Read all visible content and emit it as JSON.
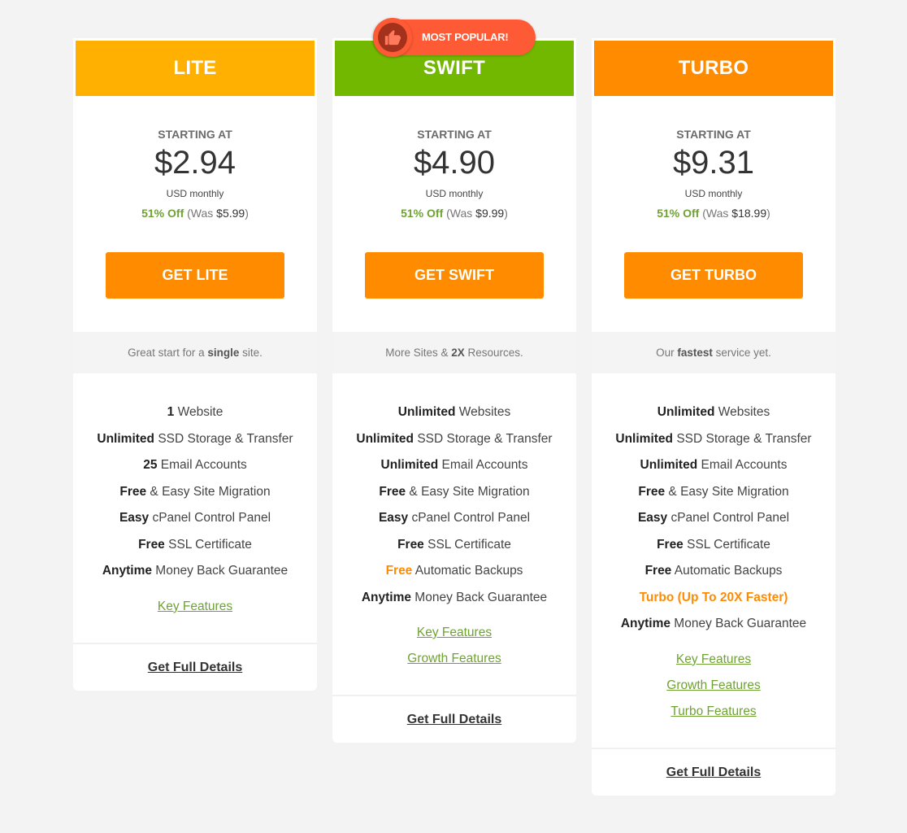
{
  "badge": {
    "label": "MOST POPULAR!",
    "icon": "thumbs-up-icon",
    "color": "#ff5a36"
  },
  "plans": [
    {
      "name": "LITE",
      "header_color": "#ffb000",
      "starting_label": "STARTING AT",
      "price": "$2.94",
      "period": "USD monthly",
      "discount": "51% Off",
      "was_prefix": "(Was ",
      "was_price": "$5.99",
      "was_suffix": ")",
      "button_label": "GET LITE",
      "tagline": {
        "before": "Great start for a ",
        "bold": "single",
        "after": " site."
      },
      "features": [
        {
          "bold": "1",
          "text": " Website"
        },
        {
          "bold": "Unlimited",
          "text": " SSD Storage & Transfer"
        },
        {
          "bold": "25",
          "text": " Email Accounts"
        },
        {
          "bold": "Free",
          "text": " & Easy Site Migration"
        },
        {
          "bold": "Easy",
          "text": " cPanel Control Panel"
        },
        {
          "bold": "Free",
          "text": " SSL Certificate"
        },
        {
          "bold": "Anytime",
          "text": " Money Back Guarantee"
        }
      ],
      "links": [
        "Key Features"
      ],
      "details_label": "Get Full Details"
    },
    {
      "name": "SWIFT",
      "header_color": "#73b800",
      "starting_label": "STARTING AT",
      "price": "$4.90",
      "period": "USD monthly",
      "discount": "51% Off",
      "was_prefix": "(Was ",
      "was_price": "$9.99",
      "was_suffix": ")",
      "button_label": "GET SWIFT",
      "tagline": {
        "before": "More Sites & ",
        "bold": "2X",
        "after": " Resources."
      },
      "features": [
        {
          "bold": "Unlimited",
          "text": " Websites"
        },
        {
          "bold": "Unlimited",
          "text": " SSD Storage & Transfer"
        },
        {
          "bold": "Unlimited",
          "text": " Email Accounts"
        },
        {
          "bold": "Free",
          "text": " & Easy Site Migration"
        },
        {
          "bold": "Easy",
          "text": " cPanel Control Panel"
        },
        {
          "bold": "Free",
          "text": " SSL Certificate"
        },
        {
          "bold": "Free",
          "text": " Automatic Backups",
          "highlight": "bold"
        },
        {
          "bold": "Anytime",
          "text": " Money Back Guarantee"
        }
      ],
      "links": [
        "Key Features",
        "Growth Features"
      ],
      "details_label": "Get Full Details"
    },
    {
      "name": "TURBO",
      "header_color": "#ff8c00",
      "starting_label": "STARTING AT",
      "price": "$9.31",
      "period": "USD monthly",
      "discount": "51% Off",
      "was_prefix": "(Was ",
      "was_price": "$18.99",
      "was_suffix": ")",
      "button_label": "GET TURBO",
      "tagline": {
        "before": "Our ",
        "bold": "fastest",
        "after": " service yet."
      },
      "features": [
        {
          "bold": "Unlimited",
          "text": " Websites"
        },
        {
          "bold": "Unlimited",
          "text": " SSD Storage & Transfer"
        },
        {
          "bold": "Unlimited",
          "text": " Email Accounts"
        },
        {
          "bold": "Free",
          "text": " & Easy Site Migration"
        },
        {
          "bold": "Easy",
          "text": " cPanel Control Panel"
        },
        {
          "bold": "Free",
          "text": " SSL Certificate"
        },
        {
          "bold": "Free",
          "text": " Automatic Backups"
        },
        {
          "bold": "Turbo (Up To 20X Faster)",
          "text": "",
          "highlight": "full"
        },
        {
          "bold": "Anytime",
          "text": " Money Back Guarantee"
        }
      ],
      "links": [
        "Key Features",
        "Growth Features",
        "Turbo Features"
      ],
      "details_label": "Get Full Details"
    }
  ],
  "colors": {
    "accent_orange": "#ff8c00",
    "link_green": "#6fa234",
    "background": "#f3f3f3"
  }
}
